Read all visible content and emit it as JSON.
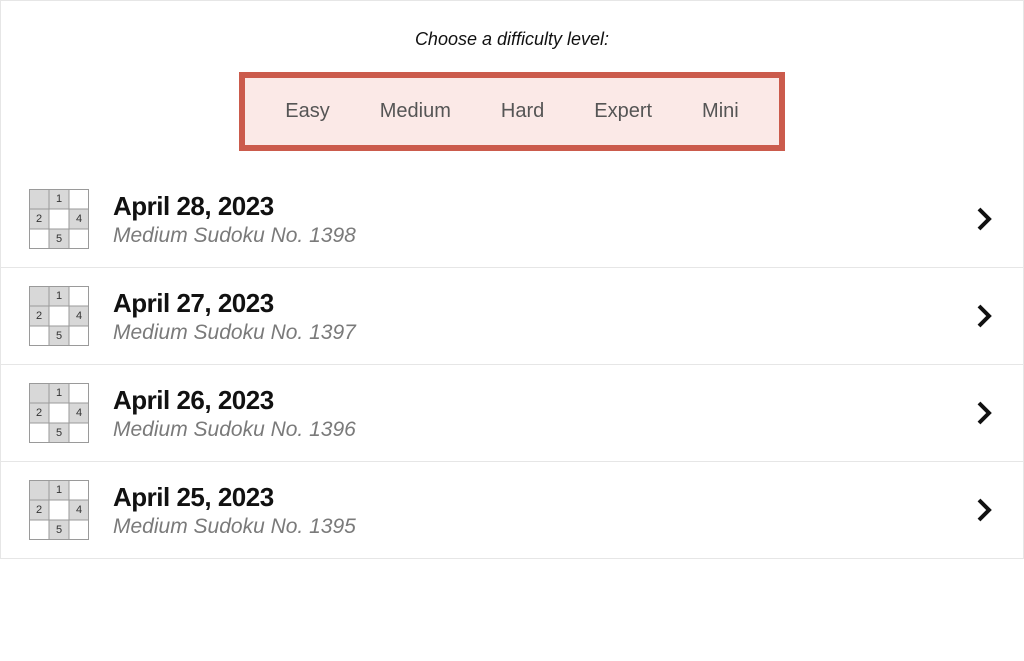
{
  "prompt": "Choose a difficulty level:",
  "difficulties": {
    "items": [
      {
        "label": "Easy"
      },
      {
        "label": "Medium"
      },
      {
        "label": "Hard"
      },
      {
        "label": "Expert"
      },
      {
        "label": "Mini"
      }
    ]
  },
  "puzzles": [
    {
      "date": "April 28, 2023",
      "subtitle": "Medium Sudoku No. 1398"
    },
    {
      "date": "April 27, 2023",
      "subtitle": "Medium Sudoku No. 1397"
    },
    {
      "date": "April 26, 2023",
      "subtitle": "Medium Sudoku No. 1396"
    },
    {
      "date": "April 25, 2023",
      "subtitle": "Medium Sudoku No. 1395"
    }
  ],
  "thumb": {
    "cells": [
      {
        "r": 0,
        "c": 0,
        "shade": true
      },
      {
        "r": 0,
        "c": 1,
        "shade": true,
        "n": "1"
      },
      {
        "r": 0,
        "c": 2,
        "shade": false
      },
      {
        "r": 1,
        "c": 0,
        "shade": true,
        "n": "2"
      },
      {
        "r": 1,
        "c": 1,
        "shade": false
      },
      {
        "r": 1,
        "c": 2,
        "shade": true,
        "n": "4"
      },
      {
        "r": 2,
        "c": 0,
        "shade": false
      },
      {
        "r": 2,
        "c": 1,
        "shade": true,
        "n": "5"
      },
      {
        "r": 2,
        "c": 2,
        "shade": false
      }
    ]
  }
}
